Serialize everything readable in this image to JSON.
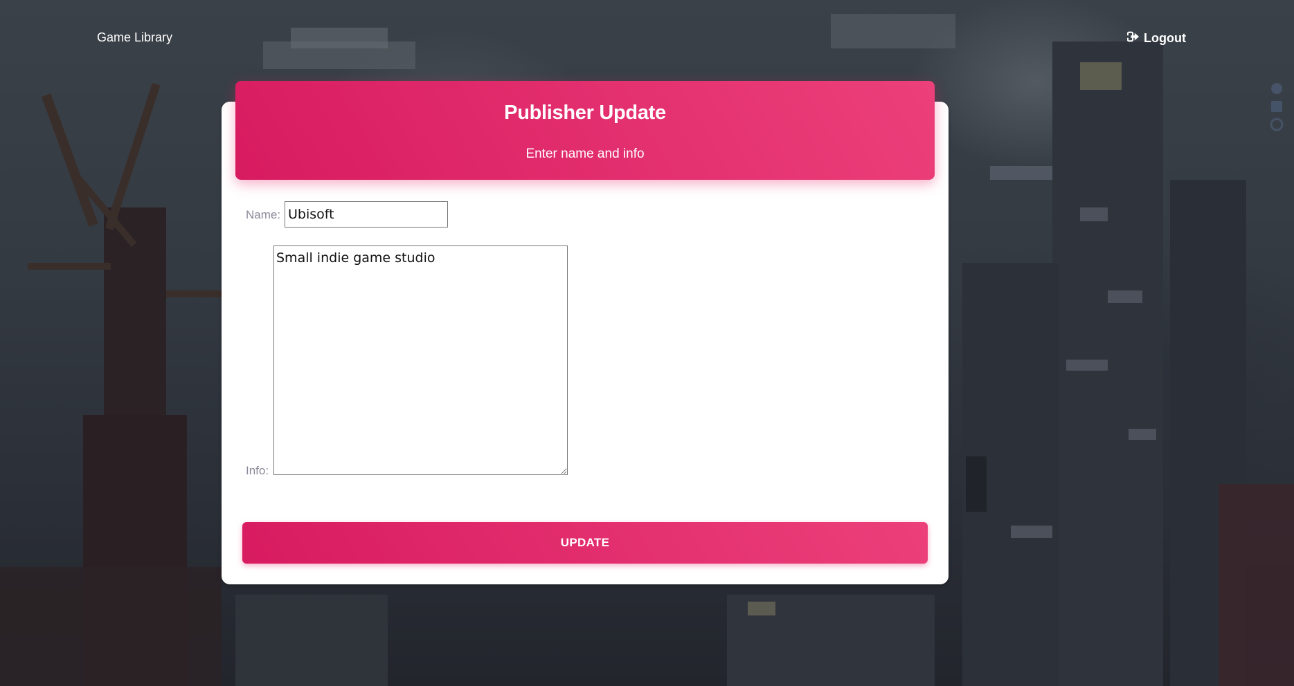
{
  "navbar": {
    "brand": "Game Library",
    "logout_label": "Logout"
  },
  "card": {
    "title": "Publisher Update",
    "subtitle": "Enter name and info"
  },
  "form": {
    "name_label": "Name:",
    "name_value": "Ubisoft",
    "info_label": "Info:",
    "info_value": "Small indie game studio",
    "submit_label": "UPDATE"
  },
  "colors": {
    "accent_start": "#d81b60",
    "accent_end": "#ec407a"
  },
  "icons": {
    "logout": "sign-out-icon",
    "side": [
      "dribbble-icon",
      "linkedin-icon",
      "github-icon"
    ]
  }
}
